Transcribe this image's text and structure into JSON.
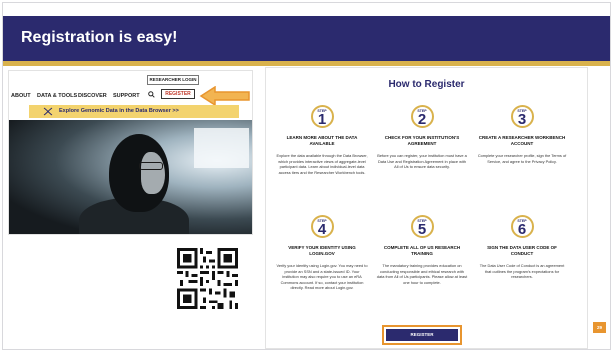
{
  "slide": {
    "title": "Registration is easy!",
    "page_number": "29"
  },
  "website": {
    "login_button": "RESEARCHER LOGIN",
    "nav": [
      "ABOUT",
      "DATA & TOOLS",
      "DISCOVER",
      "SUPPORT"
    ],
    "search_icon": "search-icon",
    "register_button": "REGISTER",
    "banner": "Explore Genomic Data in the Data Browser >>"
  },
  "how_to_register": {
    "title": "How to Register",
    "step_label": "STEP",
    "steps": [
      {
        "number": "1",
        "heading": "LEARN MORE ABOUT THE DATA AVAILABLE",
        "description": "Explore the data available through the Data Browser, which provides interactive views of aggregate-level participant data. Learn about individual-level data access tiers and the Researcher Workbench tools."
      },
      {
        "number": "2",
        "heading": "CHECK FOR YOUR INSTITUTION'S AGREEMENT",
        "description": "Before you can register, your institution must have a Data Use and Registration Agreement in place with All of Us to ensure data security."
      },
      {
        "number": "3",
        "heading": "CREATE A RESEARCHER WORKBENCH ACCOUNT",
        "description": "Complete your researcher profile, sign the Terms of Service, and agree to the Privacy Policy."
      },
      {
        "number": "4",
        "heading": "VERIFY YOUR IDENTITY USING LOGIN.GOV",
        "description": "Verify your identity using Login.gov. You may need to provide an SSN and a state-issued ID. Your institution may also require you to use an eRA Commons account. If so, contact your institution directly. Read more about Login.gov."
      },
      {
        "number": "5",
        "heading": "COMPLETE ALL OF US RESEARCH TRAINING",
        "description": "The mandatory training provides education on conducting responsible and ethical research with data from All of Us participants. Please allow at least one hour to complete."
      },
      {
        "number": "6",
        "heading": "SIGN THE DATA USER CODE OF CONDUCT",
        "description": "The Data User Code of Conduct is an agreement that outlines the program's expectations for researchers."
      }
    ],
    "register_button": "REGISTER"
  },
  "colors": {
    "brand_navy": "#2b2a6e",
    "accent_gold": "#d9b24c",
    "accent_orange": "#e8952f"
  }
}
